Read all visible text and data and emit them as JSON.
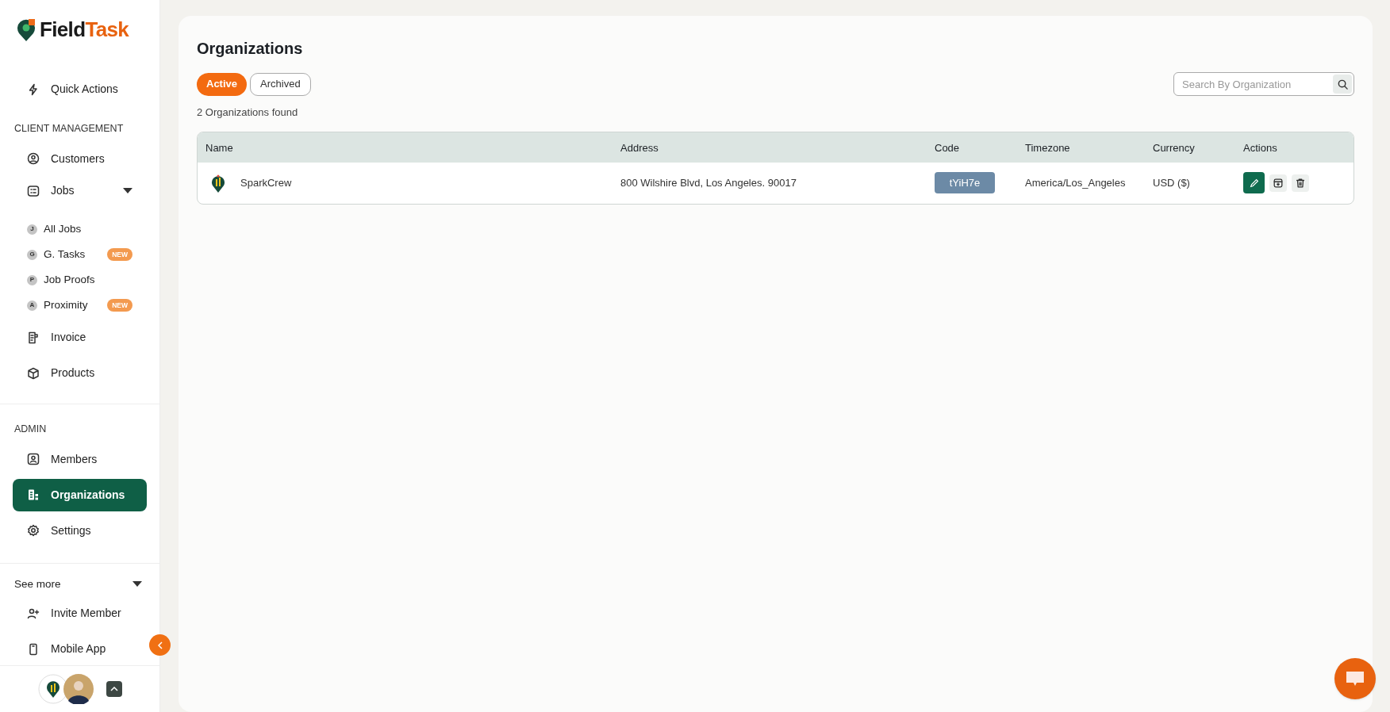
{
  "brand": {
    "part_1": "Field",
    "part_2": "Task"
  },
  "sidebar": {
    "top_items": [
      {
        "label": "Quick Actions",
        "selected": false
      }
    ],
    "sections": [
      {
        "heading": "CLIENT MANAGEMENT",
        "items": [
          {
            "kind": "link",
            "label": "Customers",
            "selected": false
          },
          {
            "kind": "group",
            "label": "Jobs",
            "selected": false,
            "expanded": true,
            "children": [
              {
                "letter": "J",
                "label": "All Jobs",
                "selected": false
              },
              {
                "letter": "G",
                "label": "G. Tasks",
                "selected": false,
                "badge": "NEW"
              },
              {
                "letter": "P",
                "label": "Job Proofs",
                "selected": false
              },
              {
                "letter": "A",
                "label": "Proximity",
                "selected": false,
                "badge": "NEW"
              }
            ]
          },
          {
            "kind": "link",
            "label": "Invoice",
            "selected": false
          },
          {
            "kind": "link",
            "label": "Products",
            "selected": false
          }
        ]
      },
      {
        "heading": "ADMIN",
        "items": [
          {
            "kind": "link",
            "label": "Members",
            "selected": false
          },
          {
            "kind": "link",
            "label": "Organizations",
            "selected": true
          },
          {
            "kind": "link",
            "label": "Settings",
            "selected": false
          }
        ]
      }
    ],
    "see_more": {
      "label": "See more",
      "expanded": true,
      "items": [
        {
          "label": "Invite Member",
          "selected": false
        },
        {
          "label": "Mobile App",
          "selected": false
        }
      ]
    }
  },
  "page": {
    "title": "Organizations",
    "tabs": [
      {
        "label": "Active",
        "selected": true
      },
      {
        "label": "Archived",
        "selected": false
      }
    ],
    "count": "2 Organizations found",
    "search": {
      "placeholder": "Search By Organization"
    },
    "table": {
      "columns": [
        "Name",
        "Address",
        "Code",
        "Timezone",
        "Currency",
        "Actions"
      ],
      "rows": [
        {
          "name": "SparkCrew",
          "address": "800 Wilshire Blvd, Los Angeles. 90017",
          "code": "tYiH7e",
          "timezone": "America/Los_Angeles",
          "currency": "USD ($)"
        }
      ]
    }
  }
}
